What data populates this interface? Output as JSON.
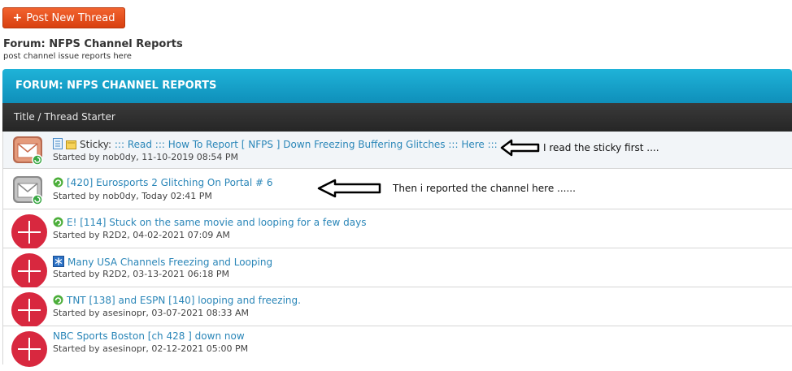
{
  "toolbar": {
    "post_button_label": "Post New Thread",
    "post_button_symbol": "+"
  },
  "forum": {
    "title": "Forum: NFPS Channel Reports",
    "description": "post channel issue reports here"
  },
  "banner": {
    "title": "FORUM: NFPS CHANNEL REPORTS"
  },
  "table": {
    "column_header": "Title / Thread Starter"
  },
  "threads": [
    {
      "prefix": "Sticky:",
      "title": "::: Read ::: How To Report [ NFPS ] Down Freezing Buffering Glitches ::: Here :::",
      "meta": "Started by nob0dy, 11-10-2019 08:54 PM",
      "status_icon": "mail-sticky-icon"
    },
    {
      "title": "[420] Eurosports 2 Glitching On Portal # 6",
      "meta": "Started by nob0dy, Today 02:41 PM",
      "status_icon": "mail-icon"
    },
    {
      "title": "E! [114] Stuck on the same movie and looping for a few days",
      "meta": "Started by R2D2, 04-02-2021 07:09 AM",
      "status_icon": "closed-icon"
    },
    {
      "title": "Many USA Channels Freezing and Looping",
      "meta": "Started by R2D2, 03-13-2021 06:18 PM",
      "status_icon": "closed-icon"
    },
    {
      "title": "TNT [138] and ESPN [140] looping and freezing.",
      "meta": "Started by asesinopr, 03-07-2021 08:33 AM",
      "status_icon": "closed-icon"
    },
    {
      "title": "NBC Sports Boston [ch 428 ] down now",
      "meta": "Started by asesinopr, 02-12-2021 05:00 PM",
      "status_icon": "closed-icon"
    }
  ],
  "annotations": {
    "first": "I read the sticky first ....",
    "second": "Then i reported the channel here ......"
  },
  "colors": {
    "accent_orange": "#e8511c",
    "banner_blue": "#1ba7cf",
    "link_blue": "#2a86b8",
    "closed_red": "#d8283f"
  }
}
